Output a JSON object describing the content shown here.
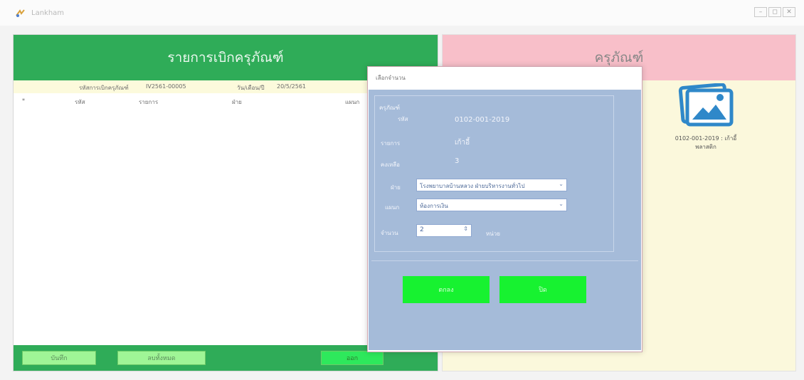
{
  "window": {
    "title": "Lankham",
    "controls": [
      "–",
      "◻",
      "✕"
    ]
  },
  "left": {
    "title": "รายการเบิกครุภัณฑ์",
    "info": {
      "code_label": "รหัสการเบิกครุภัณฑ์",
      "code_value": "IV2561-00005",
      "date_label": "วัน/เดือน/ปี",
      "date_value": "20/5/2561"
    },
    "columns": [
      "รหัส",
      "รายการ",
      "ฝ่าย",
      "แผนก"
    ],
    "buttons": {
      "save": "บันทึก",
      "delete": "ลบทั้งหมด",
      "exit": "ออก"
    }
  },
  "right": {
    "title": "ครุภัณฑ์",
    "product": {
      "code": "0102-001-2019 : เก้าอี้",
      "subtitle": "พลาสติก"
    }
  },
  "dialog": {
    "title": "เลือกจำนวน",
    "group_label": "ครุภัณฑ์",
    "code_label": "รหัส",
    "code_value": "0102-001-2019",
    "name_label": "รายการ",
    "name_value": "เก้าอี้",
    "stock_label": "คงเหลือ",
    "stock_value": "3",
    "dept_label": "ฝ่าย",
    "dept_value": "โรงพยาบาลบ้านหลวง ฝ่ายบริหารงานทั่วไป",
    "section_label": "แผนก",
    "section_value": "ห้องการเงิน",
    "qty_label": "จำนวน",
    "qty_value": "2",
    "qty_unit": "หน่วย",
    "ok_button": "ตกลง",
    "cancel_button": "ปิด"
  }
}
